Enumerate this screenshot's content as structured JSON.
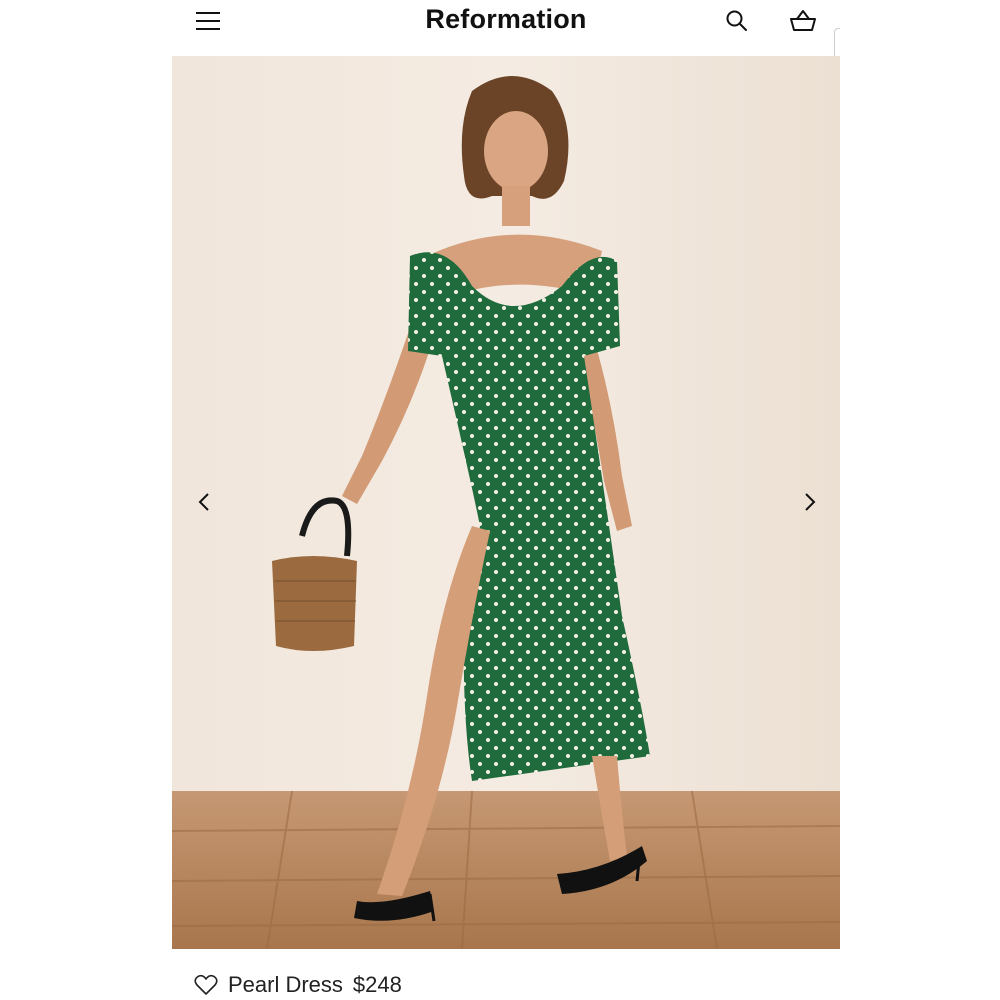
{
  "header": {
    "brand": "Reformation",
    "menu_icon": "hamburger-menu-icon",
    "search_icon": "search-icon",
    "cart_icon": "shopping-basket-icon"
  },
  "carousel": {
    "prev_icon": "chevron-left-icon",
    "next_icon": "chevron-right-icon"
  },
  "product": {
    "name": "Pearl Dress",
    "price": "$248",
    "wishlist_icon": "heart-outline-icon"
  },
  "colors": {
    "backdrop": "#efe4d8",
    "floor": "#b9875d",
    "dress": "#1f6b3c",
    "text": "#111111"
  }
}
